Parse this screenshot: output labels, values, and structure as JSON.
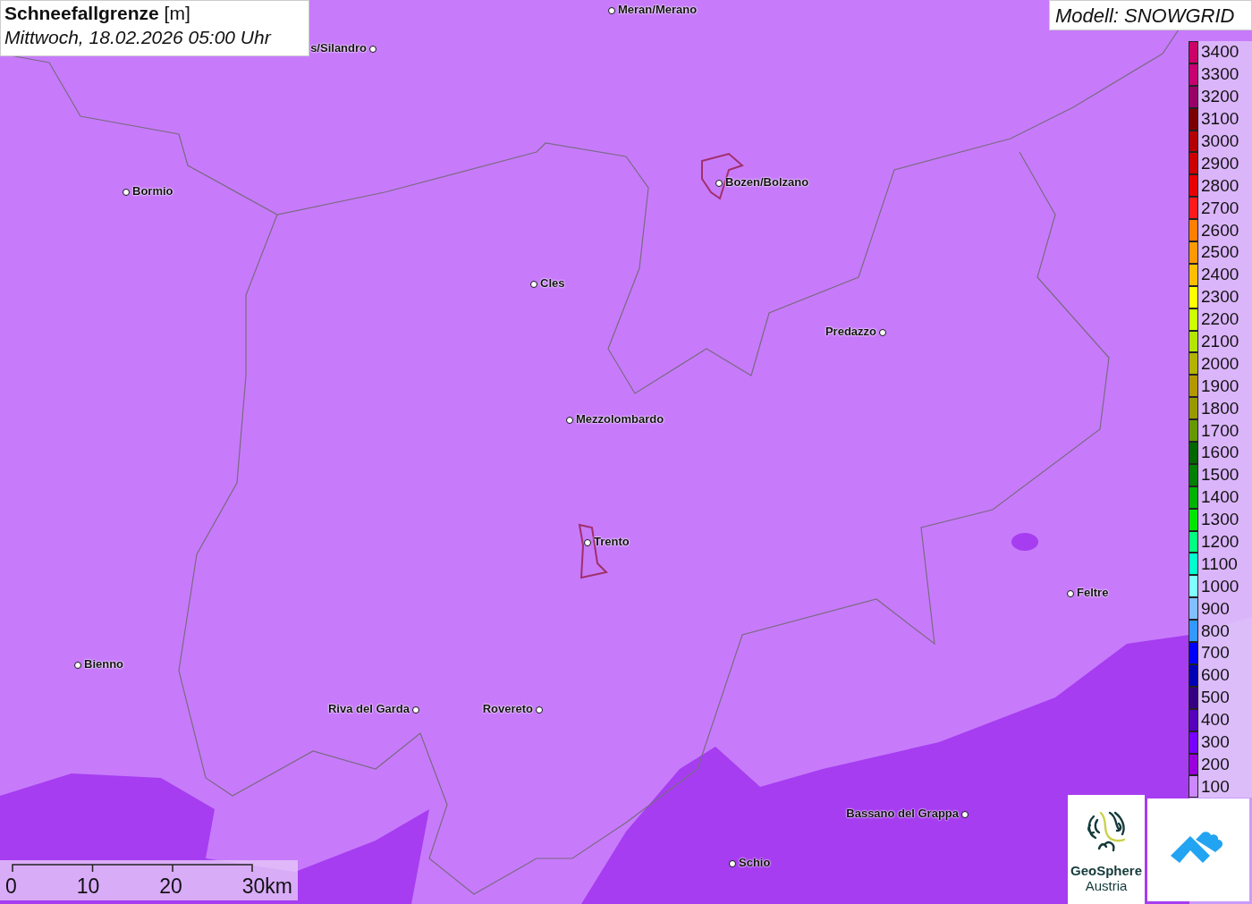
{
  "title": {
    "heading": "**Schneefallgrenze** [m]",
    "date": "Mittwoch, 18.02.2026 05:00 Uhr"
  },
  "model": "Modell: SNOWGRID",
  "places": [
    {
      "name": "Meran/Merano"
    },
    {
      "name": "s/Silandro"
    },
    {
      "name": "Bormio"
    },
    {
      "name": "Bozen/Bolzano"
    },
    {
      "name": "Cles"
    },
    {
      "name": "Predazzo"
    },
    {
      "name": "Mezzolombardo"
    },
    {
      "name": "Trento"
    },
    {
      "name": "Feltre"
    },
    {
      "name": "Bienno"
    },
    {
      "name": "Riva del Garda"
    },
    {
      "name": "Rovereto"
    },
    {
      "name": "Bassano del Grappa"
    },
    {
      "name": "Schio"
    }
  ],
  "legend": [
    {
      "label": "3400",
      "color": "#cc0066"
    },
    {
      "label": "3300",
      "color": "#c80070"
    },
    {
      "label": "3200",
      "color": "#990066"
    },
    {
      "label": "3100",
      "color": "#7a0000"
    },
    {
      "label": "3000",
      "color": "#b30000"
    },
    {
      "label": "2900",
      "color": "#cc0000"
    },
    {
      "label": "2800",
      "color": "#e60000"
    },
    {
      "label": "2700",
      "color": "#ff1a1a"
    },
    {
      "label": "2600",
      "color": "#ff8000"
    },
    {
      "label": "2500",
      "color": "#ff9900"
    },
    {
      "label": "2400",
      "color": "#ffbf00"
    },
    {
      "label": "2300",
      "color": "#ffff00"
    },
    {
      "label": "2200",
      "color": "#ccff00"
    },
    {
      "label": "2100",
      "color": "#b3e600"
    },
    {
      "label": "2000",
      "color": "#b3b300"
    },
    {
      "label": "1900",
      "color": "#b39900"
    },
    {
      "label": "1800",
      "color": "#999900"
    },
    {
      "label": "1700",
      "color": "#669900"
    },
    {
      "label": "1600",
      "color": "#006600"
    },
    {
      "label": "1500",
      "color": "#008000"
    },
    {
      "label": "1400",
      "color": "#00b300"
    },
    {
      "label": "1300",
      "color": "#00e600"
    },
    {
      "label": "1200",
      "color": "#00ff80"
    },
    {
      "label": "1100",
      "color": "#00ffcc"
    },
    {
      "label": "1000",
      "color": "#80ffff"
    },
    {
      "label": "900",
      "color": "#80c0ff"
    },
    {
      "label": "800",
      "color": "#3399ff"
    },
    {
      "label": "700",
      "color": "#0000ff"
    },
    {
      "label": "600",
      "color": "#0000b3"
    },
    {
      "label": "500",
      "color": "#330080"
    },
    {
      "label": "400",
      "color": "#5500bb"
    },
    {
      "label": "300",
      "color": "#7700ff"
    },
    {
      "label": "200",
      "color": "#9900dd"
    },
    {
      "label": "100",
      "color": "#cc88ff"
    }
  ],
  "scale": [
    "0",
    "10",
    "20",
    "30km"
  ],
  "logos": {
    "geosphere": [
      "GeoSphere",
      "Austria"
    ]
  }
}
